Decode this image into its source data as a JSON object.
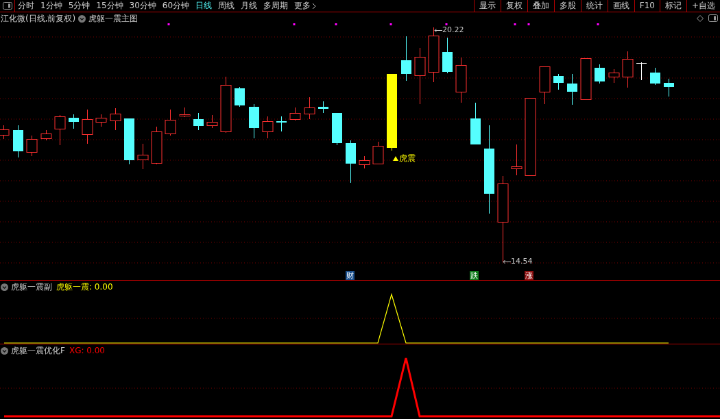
{
  "toolbar": {
    "periods": [
      {
        "label": "分时",
        "selected": false
      },
      {
        "label": "1分钟",
        "selected": false
      },
      {
        "label": "5分钟",
        "selected": false
      },
      {
        "label": "15分钟",
        "selected": false
      },
      {
        "label": "30分钟",
        "selected": false
      },
      {
        "label": "60分钟",
        "selected": false
      },
      {
        "label": "日线",
        "selected": true
      },
      {
        "label": "周线",
        "selected": false
      },
      {
        "label": "月线",
        "selected": false
      },
      {
        "label": "多周期",
        "selected": false
      }
    ],
    "more": "更多",
    "buttons": [
      "显示",
      "复权",
      "叠加",
      "多股",
      "统计",
      "画线",
      "F10",
      "标记",
      "+自选"
    ]
  },
  "main_pane": {
    "security": "江化微(日线,前复权)",
    "indicator": "虎躯一震主图",
    "high_label": "20.22",
    "low_label": "14.54",
    "signal_label": "虎震",
    "event_tags": [
      {
        "text": "财",
        "color": "#1a4f8c"
      },
      {
        "text": "跌",
        "color": "#0f7a1a"
      },
      {
        "text": "涨",
        "color": "#8c1010"
      }
    ]
  },
  "sub_panes": [
    {
      "kind": "line",
      "name": "虎躯一震副",
      "series_label": "虎躯一震:",
      "value": "0.00",
      "color": "#ffff00"
    },
    {
      "kind": "thick",
      "name": "虎躯一震优化F",
      "series_label": "XG:",
      "value": "0.00",
      "color": "#ff0000"
    }
  ]
}
